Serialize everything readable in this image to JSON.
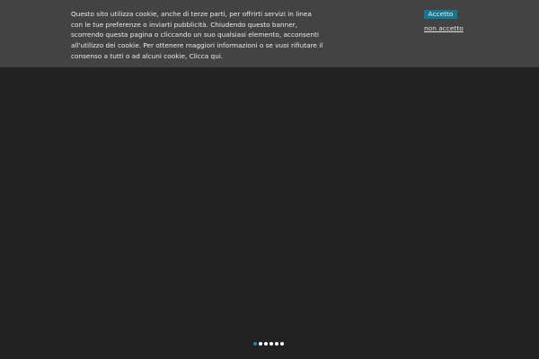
{
  "cookie_banner": {
    "message": "Questo sito utilizza cookie, anche di terze parti, per offrirti servizi in linea con le tue preferenze o inviarti pubblicità. Chiudendo questo banner, scorrendo questa pagina o cliccando un suo qualsiasi elemento, acconsenti all'utilizzo dei cookie. Per ottenere maggiori informazioni o se vuoi rifiutare il consenso a tutti o ad alcuni cookie, ",
    "link_label": "Clicca qui.",
    "accept_label": "Accetto",
    "reject_label": "non accetto"
  },
  "slider": {
    "slide_count": 6,
    "active_index": 0
  },
  "colors": {
    "page_background": "#222222",
    "banner_background": "#434343",
    "accent": "#15768f",
    "active_dot": "#1f88b5"
  }
}
